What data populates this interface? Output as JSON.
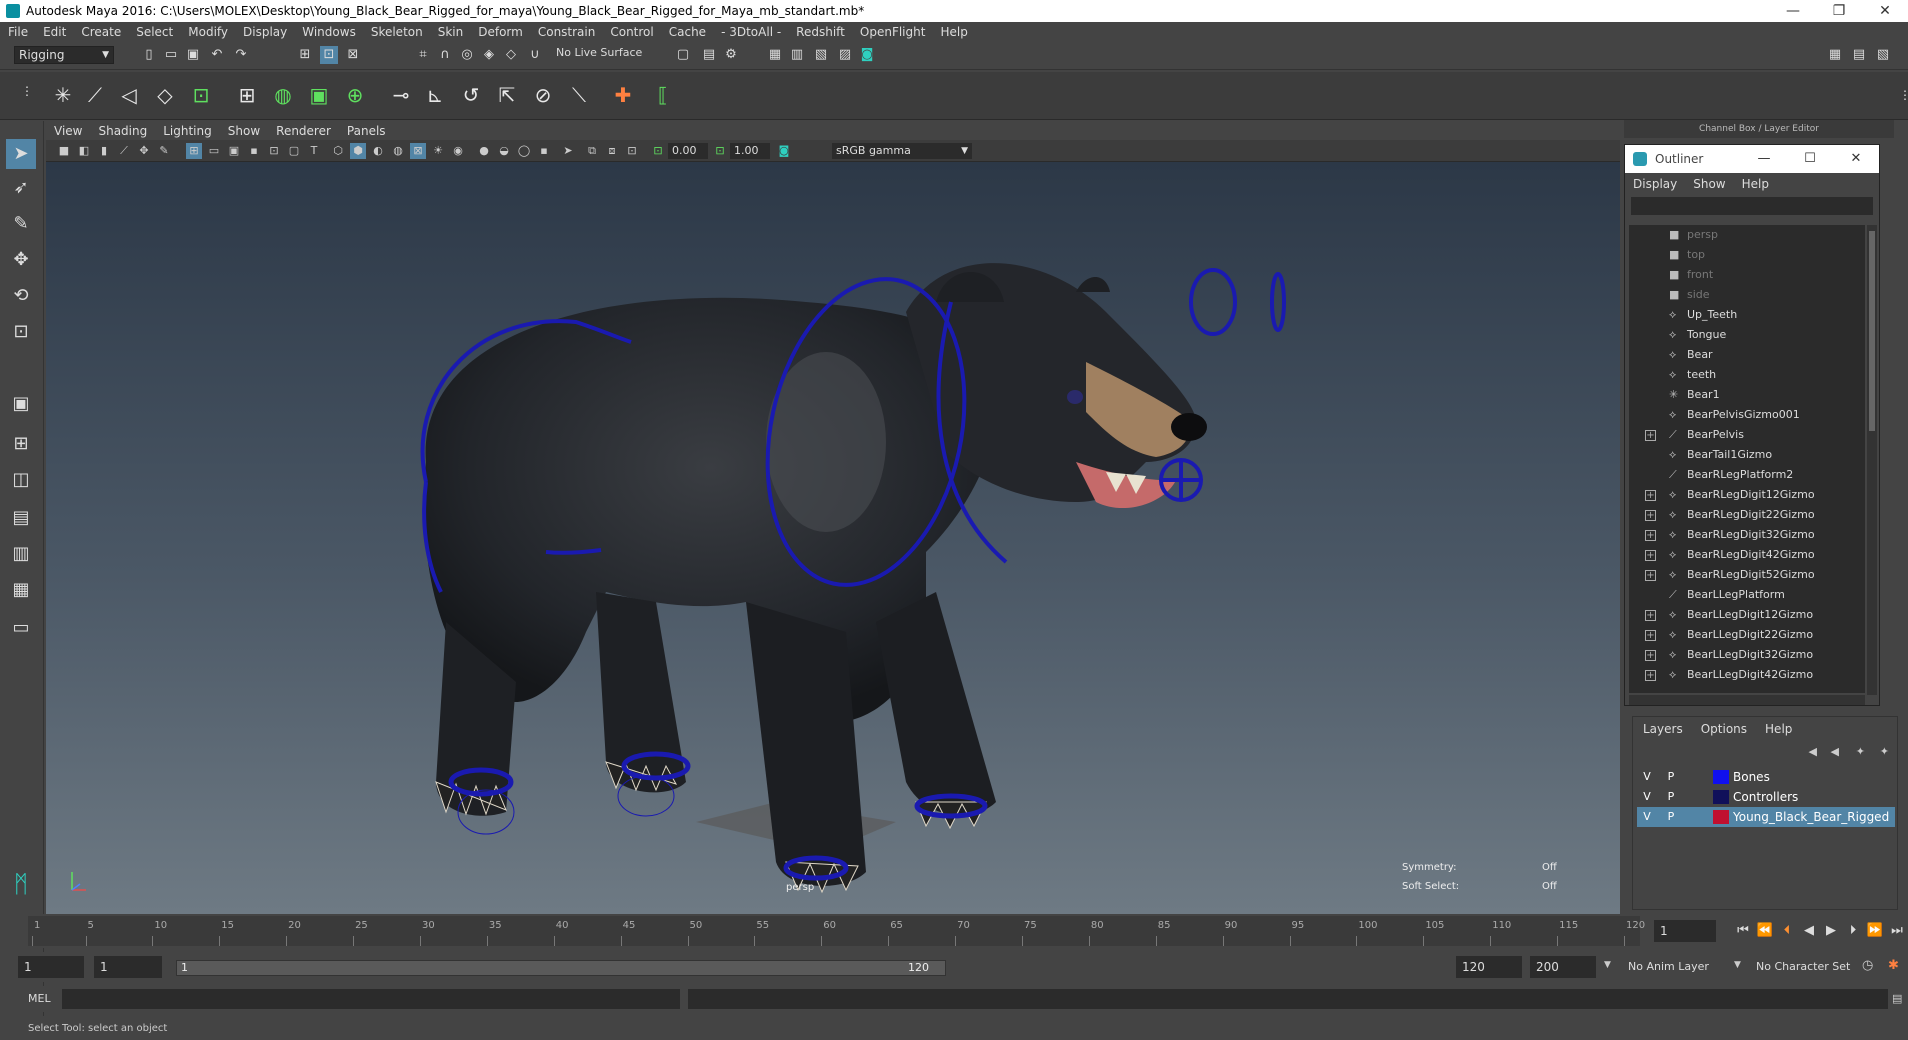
{
  "window": {
    "title": "Autodesk Maya 2016: C:\\Users\\MOLEX\\Desktop\\Young_Black_Bear_Rigged_for_maya\\Young_Black_Bear_Rigged_for_Maya_mb_standart.mb*",
    "minimize": "—",
    "restore": "❐",
    "close": "✕"
  },
  "menubar": [
    "File",
    "Edit",
    "Create",
    "Select",
    "Modify",
    "Display",
    "Windows",
    "Skeleton",
    "Skin",
    "Deform",
    "Constrain",
    "Control",
    "Cache",
    "- 3DtoAll -",
    "Redshift",
    "OpenFlight",
    "Help"
  ],
  "status": {
    "mode": "Rigging",
    "live_surface": "No Live Surface"
  },
  "viewport": {
    "menu": [
      "View",
      "Shading",
      "Lighting",
      "Show",
      "Renderer",
      "Panels"
    ],
    "near_value": "0.00",
    "far_value": "1.00",
    "color_space": "sRGB gamma",
    "camera_label": "persp",
    "symmetry_label": "Symmetry:",
    "symmetry_value": "Off",
    "soft_select_label": "Soft Select:",
    "soft_select_value": "Off"
  },
  "channel_box": {
    "title": "Channel Box / Layer Editor"
  },
  "outliner": {
    "title": "Outliner",
    "menu": [
      "Display",
      "Show",
      "Help"
    ],
    "items": [
      {
        "name": "persp",
        "type": "camera",
        "expand": false
      },
      {
        "name": "top",
        "type": "camera",
        "expand": false
      },
      {
        "name": "front",
        "type": "camera",
        "expand": false
      },
      {
        "name": "side",
        "type": "camera",
        "expand": false
      },
      {
        "name": "Up_Teeth",
        "type": "mesh",
        "expand": false
      },
      {
        "name": "Tongue",
        "type": "mesh",
        "expand": false
      },
      {
        "name": "Bear",
        "type": "mesh",
        "expand": false
      },
      {
        "name": "teeth",
        "type": "mesh",
        "expand": false
      },
      {
        "name": "Bear1",
        "type": "joint",
        "expand": false
      },
      {
        "name": "BearPelvisGizmo001",
        "type": "mesh",
        "expand": false
      },
      {
        "name": "BearPelvis",
        "type": "bone",
        "expand": true
      },
      {
        "name": "BearTail1Gizmo",
        "type": "mesh",
        "expand": false
      },
      {
        "name": "BearRLegPlatform2",
        "type": "bone",
        "expand": false
      },
      {
        "name": "BearRLegDigit12Gizmo",
        "type": "mesh",
        "expand": true
      },
      {
        "name": "BearRLegDigit22Gizmo",
        "type": "mesh",
        "expand": true
      },
      {
        "name": "BearRLegDigit32Gizmo",
        "type": "mesh",
        "expand": true
      },
      {
        "name": "BearRLegDigit42Gizmo",
        "type": "mesh",
        "expand": true
      },
      {
        "name": "BearRLegDigit52Gizmo",
        "type": "mesh",
        "expand": true
      },
      {
        "name": "BearLLegPlatform",
        "type": "bone",
        "expand": false
      },
      {
        "name": "BearLLegDigit12Gizmo",
        "type": "mesh",
        "expand": true
      },
      {
        "name": "BearLLegDigit22Gizmo",
        "type": "mesh",
        "expand": true
      },
      {
        "name": "BearLLegDigit32Gizmo",
        "type": "mesh",
        "expand": true
      },
      {
        "name": "BearLLegDigit42Gizmo",
        "type": "mesh",
        "expand": true
      }
    ]
  },
  "layers": {
    "menu": [
      "Layers",
      "Options",
      "Help"
    ],
    "rows": [
      {
        "v": "V",
        "p": "P",
        "name": "Bones",
        "color": "#1010ee",
        "selected": false
      },
      {
        "v": "V",
        "p": "P",
        "name": "Controllers",
        "color": "#10105a",
        "selected": false
      },
      {
        "v": "V",
        "p": "P",
        "name": "Young_Black_Bear_Rigged",
        "color": "#c01030",
        "selected": true
      }
    ]
  },
  "timeline": {
    "ticks": [
      1,
      5,
      10,
      15,
      20,
      25,
      30,
      35,
      40,
      45,
      50,
      55,
      60,
      65,
      70,
      75,
      80,
      85,
      90,
      95,
      100,
      105,
      110,
      115,
      120
    ],
    "current_frame": "1"
  },
  "range": {
    "start": "1",
    "playback_start": "1",
    "slider_start": "1",
    "slider_end": "120",
    "playback_end": "120",
    "end": "200",
    "anim_layer": "No Anim Layer",
    "character_set": "No Character Set"
  },
  "command": {
    "label": "MEL"
  },
  "statusline": {
    "text": "Select Tool: select an object"
  },
  "colors": {
    "accent": "#5285a6",
    "controller": "#1a1ab0"
  }
}
